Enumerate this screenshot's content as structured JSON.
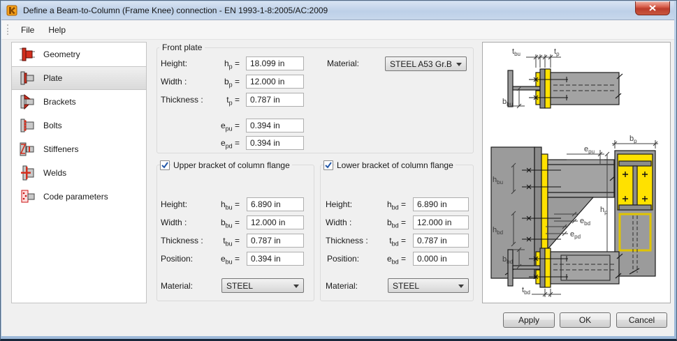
{
  "window": {
    "title": "Define a Beam-to-Column (Frame Knee) connection - EN 1993-1-8:2005/AC:2009"
  },
  "menu": {
    "items": [
      {
        "label": "File"
      },
      {
        "label": "Help"
      }
    ]
  },
  "sidebar": {
    "items": [
      {
        "label": "Geometry"
      },
      {
        "label": "Plate"
      },
      {
        "label": "Brackets"
      },
      {
        "label": "Bolts"
      },
      {
        "label": "Stiffeners"
      },
      {
        "label": "Welds"
      },
      {
        "label": "Code parameters"
      }
    ]
  },
  "ui": {
    "equals": "="
  },
  "front_plate": {
    "title": "Front plate",
    "rows": [
      {
        "label": "Height:",
        "sym": "h",
        "sub": "p",
        "value": "18.099 in"
      },
      {
        "label": "Width :",
        "sym": "b",
        "sub": "p",
        "value": "12.000 in"
      },
      {
        "label": "Thickness :",
        "sym": "t",
        "sub": "p",
        "value": "0.787 in"
      },
      {
        "label": "",
        "sym": "e",
        "sub": "pu",
        "value": "0.394 in"
      },
      {
        "label": "",
        "sym": "e",
        "sub": "pd",
        "value": "0.394 in"
      }
    ],
    "material_label": "Material:",
    "material_value": "STEEL A53 Gr.B"
  },
  "upper_bracket": {
    "title": "Upper bracket of column flange",
    "rows": [
      {
        "label": "Height:",
        "sym": "h",
        "sub": "bu",
        "value": "6.890 in"
      },
      {
        "label": "Width :",
        "sym": "b",
        "sub": "bu",
        "value": "12.000 in"
      },
      {
        "label": "Thickness :",
        "sym": "t",
        "sub": "bu",
        "value": "0.787 in"
      },
      {
        "label": "Position:",
        "sym": "e",
        "sub": "bu",
        "value": "0.394 in"
      }
    ],
    "material_label": "Material:",
    "material_value": "STEEL"
  },
  "lower_bracket": {
    "title": "Lower bracket of column flange",
    "rows": [
      {
        "label": "Height:",
        "sym": "h",
        "sub": "bd",
        "value": "6.890 in"
      },
      {
        "label": "Width :",
        "sym": "b",
        "sub": "bd",
        "value": "12.000 in"
      },
      {
        "label": "Thickness :",
        "sym": "t",
        "sub": "bd",
        "value": "0.787 in"
      },
      {
        "label": "Position:",
        "sym": "e",
        "sub": "bd",
        "value": "0.000 in"
      }
    ],
    "material_label": "Material:",
    "material_value": "STEEL"
  },
  "drawing": {
    "labels": {
      "tbu": {
        "m": "t",
        "s": "bu"
      },
      "tp": {
        "m": "t",
        "s": "p"
      },
      "bbu": {
        "m": "b",
        "s": "bu"
      },
      "hbu": {
        "m": "h",
        "s": "bu"
      },
      "hbd": {
        "m": "h",
        "s": "bd"
      },
      "epu": {
        "m": "e",
        "s": "pu"
      },
      "hp": {
        "m": "h",
        "s": "p"
      },
      "ebd": {
        "m": "e",
        "s": "bd"
      },
      "epd": {
        "m": "e",
        "s": "pd"
      },
      "bp": {
        "m": "b",
        "s": "p"
      },
      "bbd": {
        "m": "b",
        "s": "bd"
      },
      "tbd": {
        "m": "t",
        "s": "bd"
      }
    }
  },
  "footer": {
    "apply": "Apply",
    "ok": "OK",
    "cancel": "Cancel"
  },
  "colors": {
    "accent_red": "#d32f1e",
    "plate_yellow": "#ffe100",
    "steel_gray": "#9b9b9b",
    "title_blue": "#c3d5ea"
  }
}
